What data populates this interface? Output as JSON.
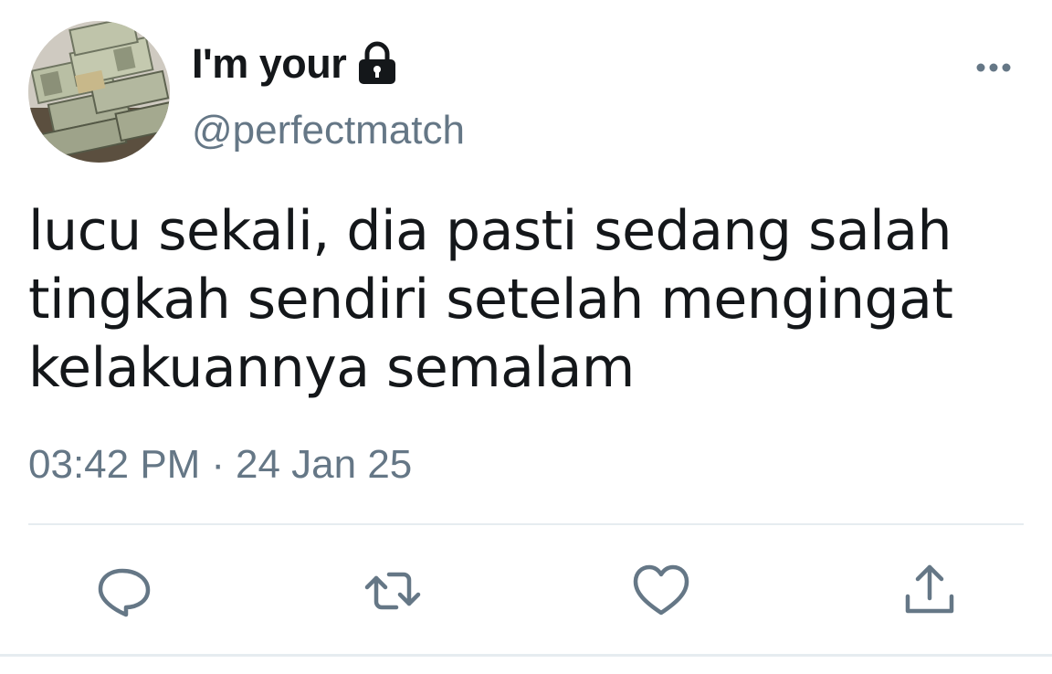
{
  "tweet": {
    "display_name": "I'm your",
    "handle": "@perfectmatch",
    "text": "lucu sekali, dia pasti sedang salah tingkah sendiri setelah mengingat kelakuannya semalam",
    "time": "03:42 PM",
    "separator": "·",
    "date": "24 Jan 25",
    "protected_icon": "lock-icon",
    "avatar_subject": "stacks of dollar banknotes"
  },
  "icons": {
    "more": "more-horizontal-icon",
    "reply": "reply-icon",
    "retweet": "retweet-icon",
    "like": "heart-icon",
    "share": "share-icon"
  },
  "colors": {
    "text_primary": "#14171a",
    "text_secondary": "#657786",
    "divider": "#e6ecf0",
    "background": "#ffffff"
  }
}
